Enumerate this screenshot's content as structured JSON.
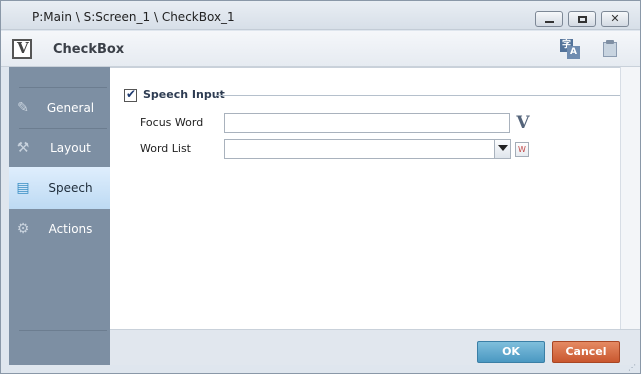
{
  "window": {
    "title": "P:Main \\ S:Screen_1 \\ CheckBox_1",
    "minimize_icon": "minimize-icon",
    "maximize_icon": "maximize-icon",
    "close_icon": "close-icon",
    "close_glyph": "✕"
  },
  "header": {
    "title": "CheckBox",
    "icon_glyph": "V",
    "translate_glyph_a": "字",
    "translate_glyph_b": "A"
  },
  "sidebar": {
    "items": [
      {
        "label": "General",
        "icon": "pencil-icon",
        "glyph": "✎",
        "active": false
      },
      {
        "label": "Layout",
        "icon": "wrench-icon",
        "glyph": "⚒",
        "active": false
      },
      {
        "label": "Speech",
        "icon": "speech-bubble-icon",
        "glyph": "▤",
        "active": true
      },
      {
        "label": "Actions",
        "icon": "actions-icon",
        "glyph": "⚙",
        "active": false
      }
    ]
  },
  "speech": {
    "group_label": "Speech Input",
    "group_checked": true,
    "check_glyph": "✔",
    "focus_word_label": "Focus Word",
    "focus_word_value": "",
    "word_list_label": "Word List",
    "word_list_value": "",
    "v_icon_glyph": "V",
    "w_icon_glyph": "W"
  },
  "footer": {
    "ok_label": "OK",
    "cancel_label": "Cancel"
  },
  "colors": {
    "sidebar": "#7d8fa3",
    "active_item": "#bddaf3",
    "ok": "#4a98c2",
    "cancel": "#c9572f"
  }
}
